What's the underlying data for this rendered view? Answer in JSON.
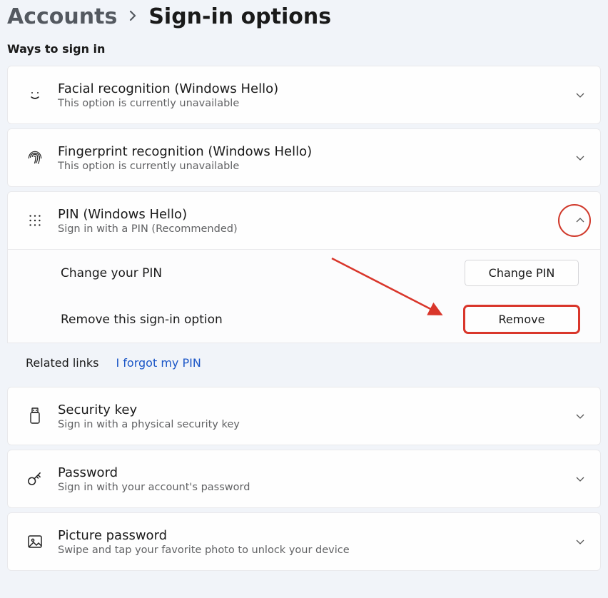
{
  "breadcrumb": {
    "parent": "Accounts",
    "current": "Sign-in options"
  },
  "section_title": "Ways to sign in",
  "options": {
    "facial": {
      "title": "Facial recognition (Windows Hello)",
      "sub": "This option is currently unavailable"
    },
    "fingerprint": {
      "title": "Fingerprint recognition (Windows Hello)",
      "sub": "This option is currently unavailable"
    },
    "pin": {
      "title": "PIN (Windows Hello)",
      "sub": "Sign in with a PIN (Recommended)",
      "change_label": "Change your PIN",
      "change_btn": "Change PIN",
      "remove_label": "Remove this sign-in option",
      "remove_btn": "Remove",
      "related_label": "Related links",
      "forgot_link": "I forgot my PIN"
    },
    "security_key": {
      "title": "Security key",
      "sub": "Sign in with a physical security key"
    },
    "password": {
      "title": "Password",
      "sub": "Sign in with your account's password"
    },
    "picture": {
      "title": "Picture password",
      "sub": "Swipe and tap your favorite photo to unlock your device"
    }
  }
}
